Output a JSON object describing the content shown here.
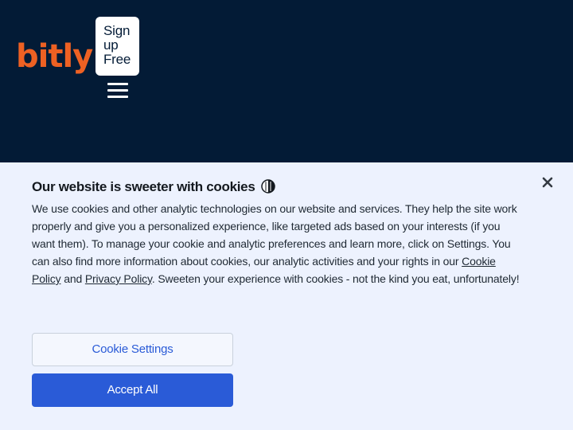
{
  "header": {
    "logo_text": "bitly",
    "signup_lines": [
      "Sign",
      "up",
      "Free"
    ],
    "menu_icon": "hamburger-menu-icon"
  },
  "cookie_banner": {
    "title": "Our website is sweeter with cookies",
    "title_icon": "cookie-icon",
    "text_before_cookie_link": "We use cookies and other analytic technologies on our website and services. They help the site work properly and give you a personalized experience, like targeted ads based on your interests (if you want them). To manage your cookie and analytic preferences and learn more, click on Settings. You can also find more information about cookies, our analytic activities and your rights in our ",
    "cookie_policy_link": "Cookie Policy",
    "text_between_links": " and ",
    "privacy_policy_link": "Privacy Policy",
    "text_after_links": ". Sweeten your experience with cookies - not the kind you eat, unfortunately!",
    "close_icon": "close-icon",
    "settings_button": "Cookie Settings",
    "accept_button": "Accept All"
  },
  "colors": {
    "header_bg": "#031b36",
    "logo_orange": "#ee6123",
    "banner_bg": "#edf2fe",
    "primary_blue": "#2a5bd7"
  }
}
